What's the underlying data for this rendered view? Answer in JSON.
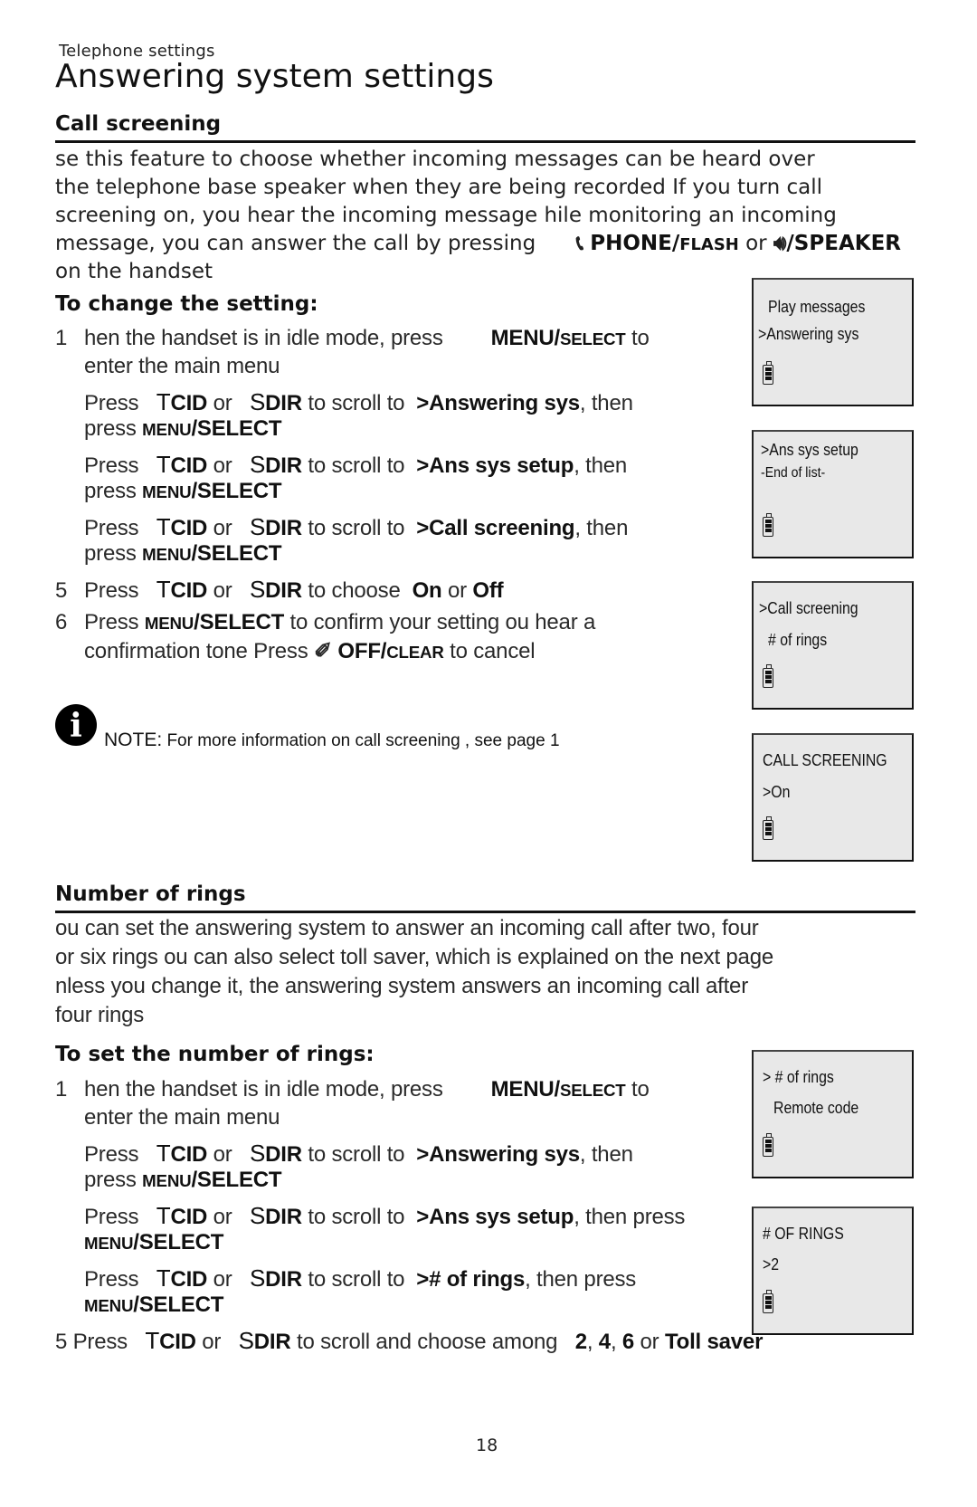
{
  "header": {
    "section": "Telephone settings",
    "title": "Answering system settings"
  },
  "call_screening": {
    "heading": "Call screening",
    "intro_lines": [
      "se this feature to choose whether incoming messages can be heard over",
      "the telephone base speaker when they are being recorded If you turn call",
      "screening on, you hear the incoming message hile monitoring          an incoming",
      "message,  you can answer the call by pressing",
      "on the handset"
    ],
    "phone_key": "PHONE/",
    "phone_key_sc": "FLASH",
    "or": "or",
    "speaker_key": "/SPEAKER",
    "subheading": "To change the setting:",
    "step1": {
      "num": "1",
      "text": "hen the handset is in idle mode, press",
      "key": "MENU/",
      "key_sc": "SELECT",
      "after": "to",
      "cont": "enter the main menu"
    },
    "scroll_press": "Press",
    "t_letter": "T",
    "cid": "CID",
    "s_letter": "S",
    "dir": "DIR",
    "scroll_to": "to scroll to",
    "then": ", then",
    "press": "press",
    "menu_sc": "MENU",
    "select": "/SELECT",
    "step2_target": ">Answering sys",
    "step3_target": ">Ans sys setup",
    "step4_target": ">Call screening",
    "step5": {
      "num": "5",
      "text": "to choose",
      "on": "On",
      "off": "Off"
    },
    "step6": {
      "num": "6",
      "press": "Press",
      "after": "to confirm your setting   ou hear     a",
      "cont": "confirmation tone   Press",
      "off_key": "OFF/",
      "off_key_sc": "CLEAR",
      "cancel": "to  cancel"
    },
    "note": {
      "label": "NOTE:",
      "text": "For more information on call screening   , see page 1"
    }
  },
  "lcd_screens": [
    {
      "rows": [
        "Play messages",
        ">Answering sys"
      ]
    },
    {
      "rows": [
        ">Ans sys setup",
        "-End of list-"
      ]
    },
    {
      "rows": [
        ">Call screening",
        "# of rings"
      ]
    },
    {
      "rows": [
        "CALL SCREENING",
        ">On"
      ]
    },
    {
      "rows": [
        ">  # of rings",
        "Remote code"
      ]
    },
    {
      "rows": [
        "# OF RINGS",
        ">2"
      ]
    }
  ],
  "number_of_rings": {
    "heading": "Number of rings",
    "intro_lines": [
      "ou can set the answering system to answer an incoming call after two, four",
      "or six rings ou can also select toll saver, which is explained on the next page",
      "nless you change it, the answering system answers an incoming call after",
      "four rings"
    ],
    "subheading": "To set the number of rings:",
    "step1": {
      "num": "1",
      "text": "hen the handset is in idle mode, press",
      "key": "MENU/",
      "key_sc": "SELECT",
      "after": "to",
      "cont": "enter the main menu"
    },
    "step2_target": ">Answering sys",
    "step3_target": ">Ans sys setup",
    "step3_then": ", then press",
    "step4_target": "># of rings",
    "step5": {
      "num": "5",
      "press": "Press",
      "text": "to scroll and choose among",
      "v2": "2",
      "v4": "4",
      "v6": "6",
      "or": "or",
      "toll": "Toll saver"
    }
  },
  "footer": {
    "page_number": "18"
  }
}
